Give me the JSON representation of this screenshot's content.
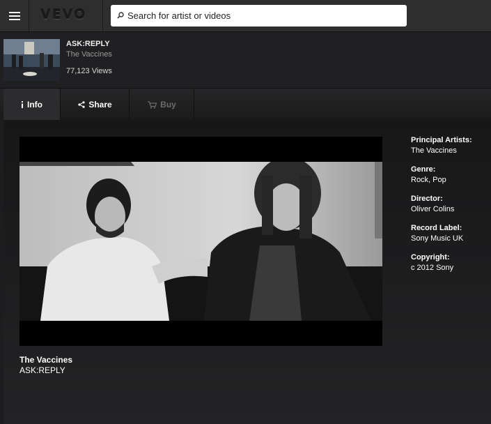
{
  "header": {
    "menu_icon": "hamburger-icon",
    "logo": "VEVO",
    "search": {
      "placeholder": "Search for artist or videos",
      "icon": "search-icon"
    }
  },
  "now_playing": {
    "title": "ASK:REPLY",
    "artist": "The Vaccines",
    "views": "77,123 Views"
  },
  "tabs": [
    {
      "label": "Info",
      "icon": "info-icon",
      "active": true
    },
    {
      "label": "Share",
      "icon": "share-icon",
      "active": false
    },
    {
      "label": "Buy",
      "icon": "cart-icon",
      "active": false,
      "disabled": true
    }
  ],
  "caption": {
    "artist": "The Vaccines",
    "title": "ASK:REPLY"
  },
  "metadata": [
    {
      "label": "Principal Artists:",
      "value": "The Vaccines"
    },
    {
      "label": "Genre:",
      "value": "Rock, Pop"
    },
    {
      "label": "Director:",
      "value": "Oliver Colins"
    },
    {
      "label": "Record Label:",
      "value": "Sony Music UK"
    },
    {
      "label": "Copyright:",
      "value": "c 2012 Sony"
    }
  ],
  "colors": {
    "background": "#1d1d1f",
    "topbar": "#2e2e2f",
    "tab_active": "#2c2c2e",
    "tab_disabled": "#6c6c6c"
  }
}
